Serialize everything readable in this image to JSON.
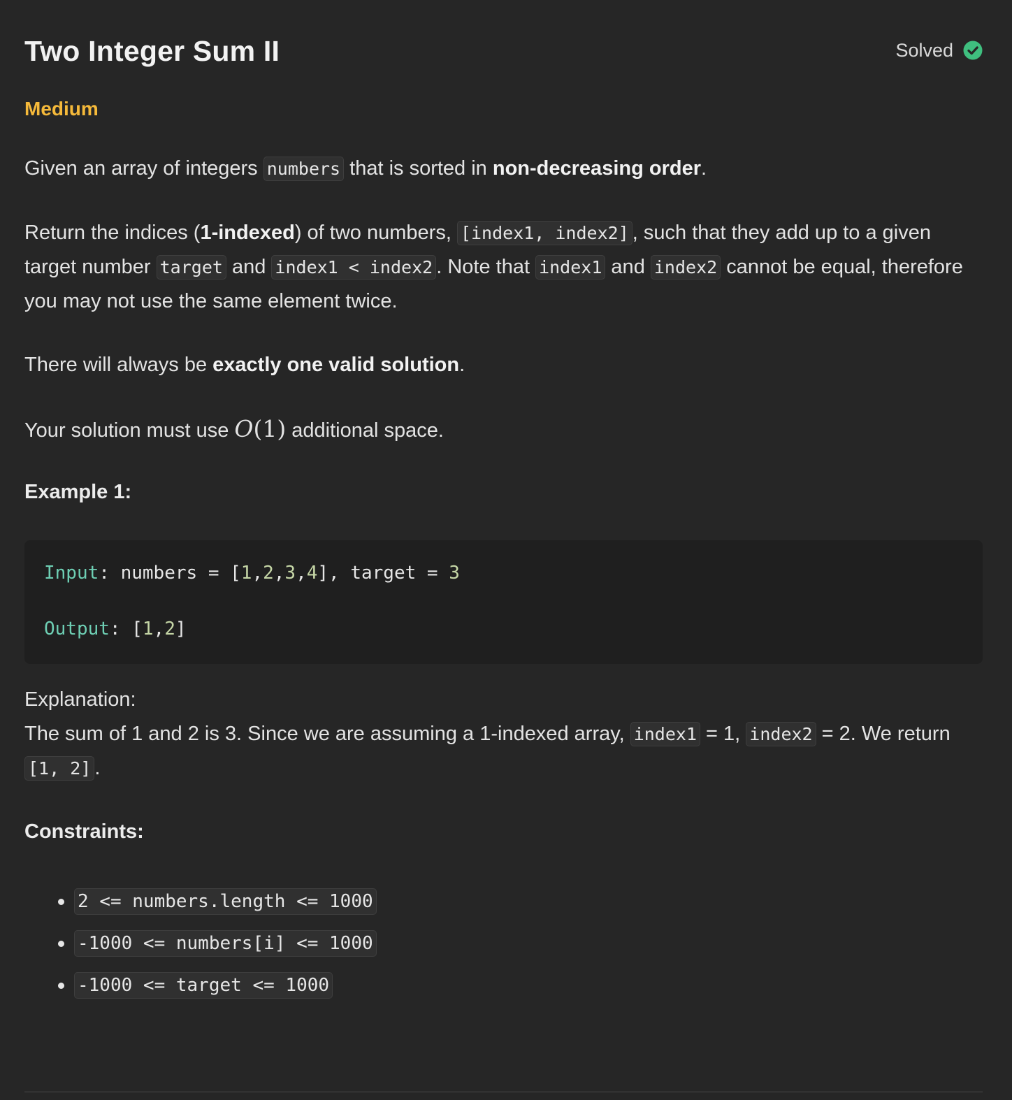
{
  "problem": {
    "title": "Two Integer Sum II",
    "status": "Solved",
    "difficulty": "Medium",
    "colors": {
      "difficulty": "#f5b93a",
      "solved_check": "#3fbf7f",
      "background": "#262626"
    }
  },
  "description": {
    "p1": {
      "t1": "Given an array of integers ",
      "c1": "numbers",
      "t2": " that is sorted in ",
      "b1": "non-decreasing order",
      "t3": "."
    },
    "p2": {
      "t1": "Return the indices (",
      "b1": "1-indexed",
      "t2": ") of two numbers, ",
      "c1": "[index1, index2]",
      "t3": ", such that they add up to a given target number ",
      "c2": "target",
      "t4": " and ",
      "c3": "index1 < index2",
      "t5": ". Note that ",
      "c4": "index1",
      "t6": " and ",
      "c5": "index2",
      "t7": " cannot be equal, therefore you may not use the same element twice."
    },
    "p3": {
      "t1": "There will always be ",
      "b1": "exactly one valid solution",
      "t2": "."
    },
    "p4": {
      "t1": "Your solution must use ",
      "m_o": "O",
      "m_rest": "(1)",
      "t2": " additional space."
    }
  },
  "example1": {
    "heading": "Example 1:",
    "input_kw": "Input",
    "input_pre": ": numbers = [",
    "n1": "1",
    "n2": "2",
    "n3": "3",
    "n4": "4",
    "input_mid": "], target = ",
    "n5": "3",
    "output_kw": "Output",
    "output_pre": ": [",
    "o1": "1",
    "o2": "2",
    "output_post": "]",
    "comma": ",",
    "explanation_label": "Explanation:",
    "exp": {
      "t1": "The sum of 1 and 2 is 3. Since we are assuming a 1-indexed array, ",
      "c1": "index1",
      "t2": " = 1, ",
      "c2": "index2",
      "t3": " = 2. We return ",
      "c3": "[1, 2]",
      "t4": "."
    }
  },
  "constraints": {
    "heading": "Constraints:",
    "items": [
      "2 <= numbers.length <= 1000",
      "-1000 <= numbers[i] <= 1000",
      "-1000 <= target <= 1000"
    ]
  }
}
